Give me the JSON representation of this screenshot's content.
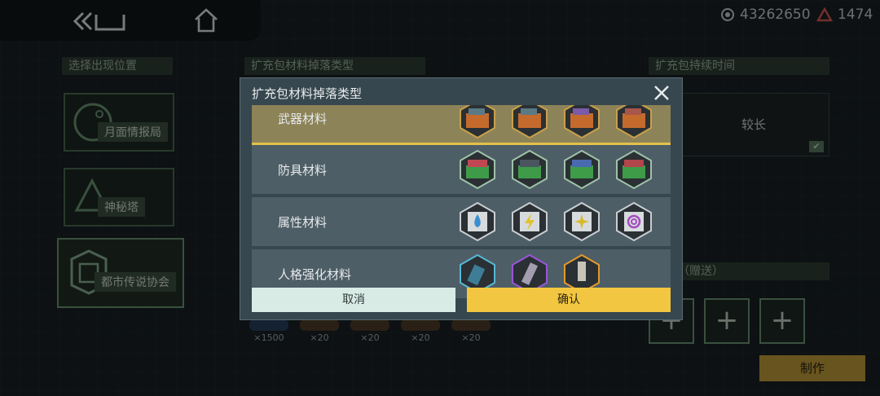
{
  "currency": {
    "coins": "43262650",
    "gems": "1474"
  },
  "left": {
    "header": "选择出现位置",
    "locations": [
      {
        "label": "月面情报局",
        "selected": false
      },
      {
        "label": "神秘塔",
        "selected": false
      },
      {
        "label": "都市传说协会",
        "selected": true
      }
    ]
  },
  "middle": {
    "header": "扩充包材料掉落类型",
    "items": [
      {
        "count": "×1500"
      },
      {
        "count": "×20"
      },
      {
        "count": "×20"
      },
      {
        "count": "×20"
      },
      {
        "count": "×20"
      }
    ]
  },
  "right": {
    "duration_header": "扩充包持续时间",
    "duration_value": "较长",
    "gift_header": "礼物（赠送）",
    "craft_label": "制作"
  },
  "modal": {
    "title": "扩充包材料掉落类型",
    "rows": [
      {
        "label": "武器材料",
        "selected": true,
        "icon_theme": "weapon-crate-icon"
      },
      {
        "label": "防具材料",
        "selected": false,
        "icon_theme": "armor-crate-icon"
      },
      {
        "label": "属性材料",
        "selected": false,
        "icon_theme": "attribute-chip-icon"
      },
      {
        "label": "人格强化材料",
        "selected": false,
        "icon_theme": "persona-upgrade-icon"
      }
    ],
    "cancel_label": "取消",
    "confirm_label": "确认"
  },
  "colors": {
    "accent_yellow": "#f2c640",
    "selected_row": "#8d8358",
    "green_frame": "#6f9a7a"
  }
}
